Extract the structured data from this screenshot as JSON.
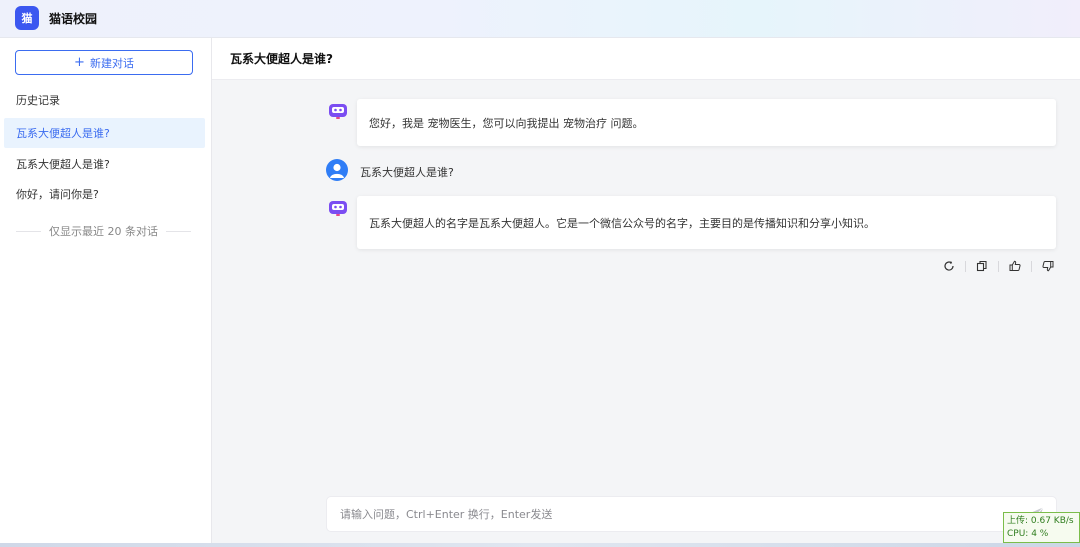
{
  "app": {
    "logo_char": "猫",
    "title": "猫语校园"
  },
  "sidebar": {
    "new_chat_label": "新建对话",
    "history_title": "历史记录",
    "items": [
      {
        "label": "瓦系大便超人是谁?",
        "active": true
      },
      {
        "label": "瓦系大便超人是谁?",
        "active": false
      },
      {
        "label": "你好，请问你是?",
        "active": false
      }
    ],
    "note": "仅显示最近 20 条对话"
  },
  "chat": {
    "title": "瓦系大便超人是谁?",
    "messages": [
      {
        "role": "bot",
        "text": "您好，我是 宠物医生，您可以向我提出 宠物治疗 问题。"
      },
      {
        "role": "user",
        "text": "瓦系大便超人是谁?"
      },
      {
        "role": "bot",
        "text": "瓦系大便超人的名字是瓦系大便超人。它是一个微信公众号的名字，主要目的是传播知识和分享小知识。"
      }
    ],
    "actions": [
      "refresh-icon",
      "copy-icon",
      "thumbs-up-icon",
      "thumbs-down-icon"
    ]
  },
  "input": {
    "placeholder": "请输入问题，Ctrl+Enter 换行，Enter发送",
    "value": ""
  },
  "monitor": {
    "upload": "上传: 0.67 KB/s",
    "cpu": "CPU: 4 %"
  },
  "colors": {
    "accent": "#3b6cf0",
    "logo_bg": "#3b57f0",
    "bot_icon": "#7b4df2",
    "user_avatar": "#2f7df6"
  }
}
